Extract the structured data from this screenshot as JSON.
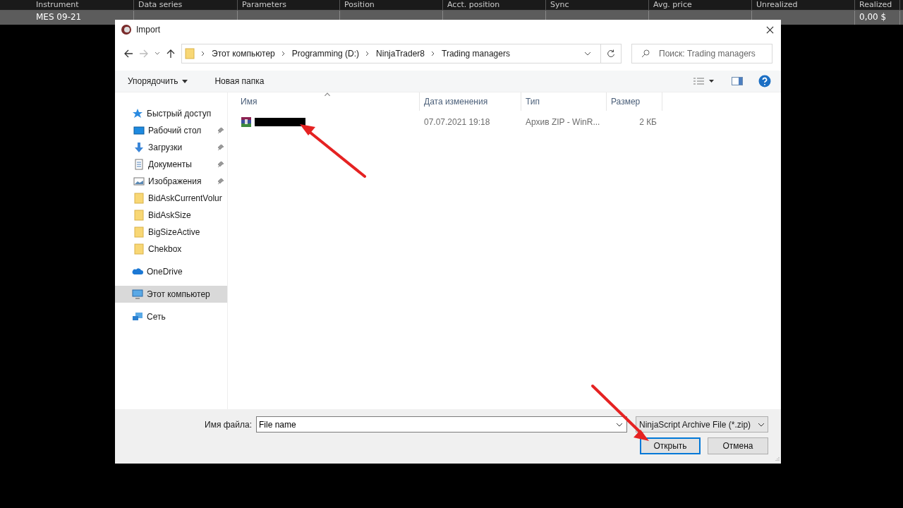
{
  "background_table": {
    "columns": [
      "Instrument",
      "Data series",
      "Parameters",
      "Position",
      "Acct. position",
      "Sync",
      "Avg. price",
      "Unrealized",
      "Realized"
    ],
    "row": {
      "instrument": "MES 09-21",
      "realized": "0,00 $"
    }
  },
  "dialog": {
    "title": "Import",
    "breadcrumb": [
      "Этот компьютер",
      "Programming (D:)",
      "NinjaTrader8",
      "Trading managers"
    ],
    "search": {
      "placeholder": "Поиск: Trading managers"
    },
    "toolbar": [
      "Упорядочить",
      "Новая папка"
    ],
    "sidebar": [
      {
        "label": "Быстрый доступ",
        "kind": "star",
        "pinned": false,
        "selected": false,
        "children": [
          {
            "label": "Рабочий стол",
            "kind": "desktop",
            "pinned": true,
            "selected": false
          },
          {
            "label": "Загрузки",
            "kind": "download",
            "pinned": true,
            "selected": false
          },
          {
            "label": "Документы",
            "kind": "document",
            "pinned": true,
            "selected": false
          },
          {
            "label": "Изображения",
            "kind": "image",
            "pinned": true,
            "selected": false
          },
          {
            "label": "BidAskCurrentVolur",
            "kind": "folder",
            "pinned": false,
            "selected": false
          },
          {
            "label": "BidAskSize",
            "kind": "folder",
            "pinned": false,
            "selected": false
          },
          {
            "label": "BigSizeActive",
            "kind": "folder",
            "pinned": false,
            "selected": false
          },
          {
            "label": "Chekbox",
            "kind": "folder",
            "pinned": false,
            "selected": false
          }
        ]
      },
      {
        "label": "OneDrive",
        "kind": "cloud",
        "pinned": false,
        "selected": false
      },
      {
        "label": "Этот компьютер",
        "kind": "computer",
        "pinned": false,
        "selected": true
      },
      {
        "label": "Сеть",
        "kind": "network",
        "pinned": false,
        "selected": false
      }
    ],
    "columns": [
      "Имя",
      "Дата изменения",
      "Тип",
      "Размер"
    ],
    "files": [
      {
        "date": "07.07.2021 19:18",
        "type": "Архив ZIP - WinR...",
        "size": "2 КБ"
      }
    ],
    "filename_label": "Имя файла:",
    "filename": "File name",
    "filter": "NinjaScript Archive File (*.zip)",
    "buttons": [
      "Открыть",
      "Отмена"
    ]
  }
}
